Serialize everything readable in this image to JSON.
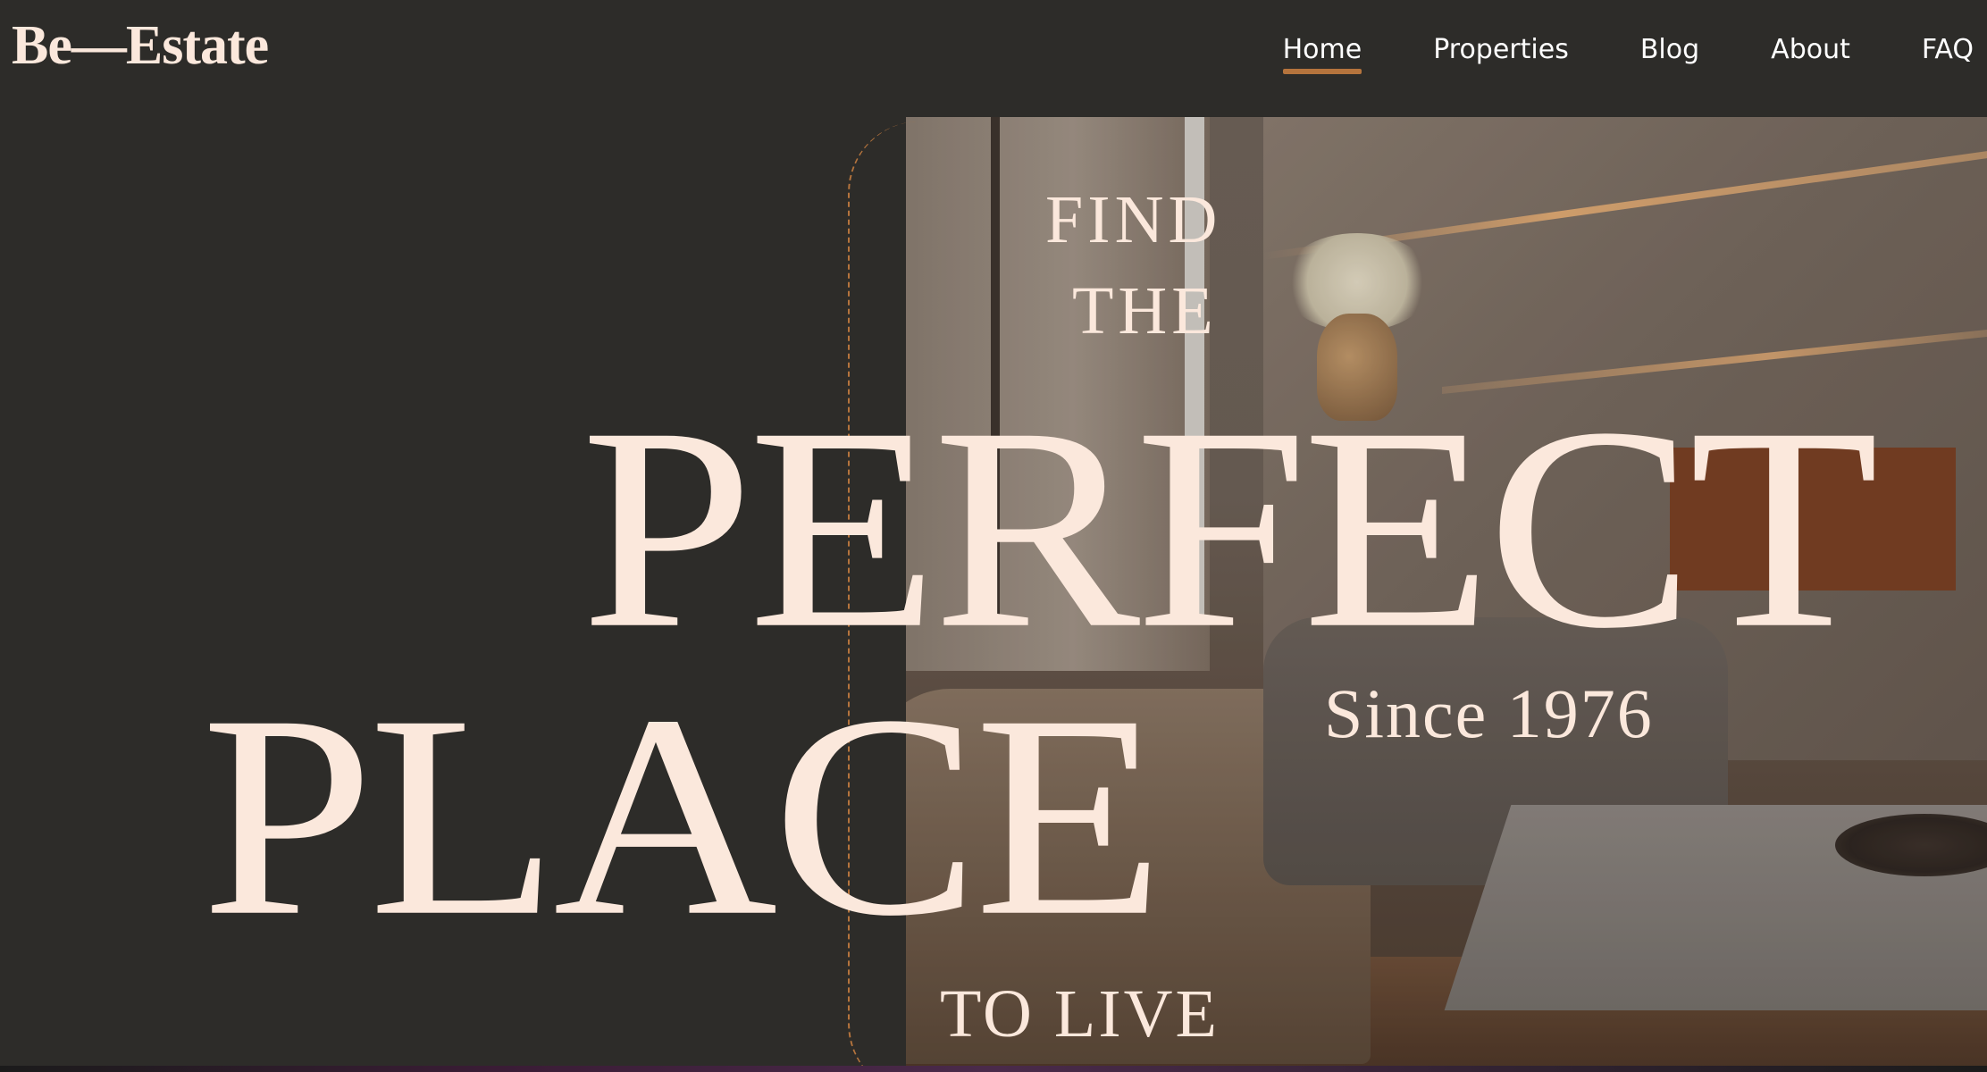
{
  "header": {
    "logo": "Be—Estate",
    "nav": [
      {
        "label": "Home",
        "active": true
      },
      {
        "label": "Properties",
        "active": false
      },
      {
        "label": "Blog",
        "active": false
      },
      {
        "label": "About",
        "active": false
      },
      {
        "label": "FAQ",
        "active": false
      }
    ]
  },
  "hero": {
    "line_find": "FIND",
    "line_the": "THE",
    "line_perfect": "PERFECT",
    "line_place": "PLACE",
    "since": "Since 1976",
    "line_to_live": "TO LIVE"
  },
  "colors": {
    "background": "#2d2c29",
    "text": "#fbe8dc",
    "accent": "#b5743d",
    "nav_text": "#ffffff"
  }
}
